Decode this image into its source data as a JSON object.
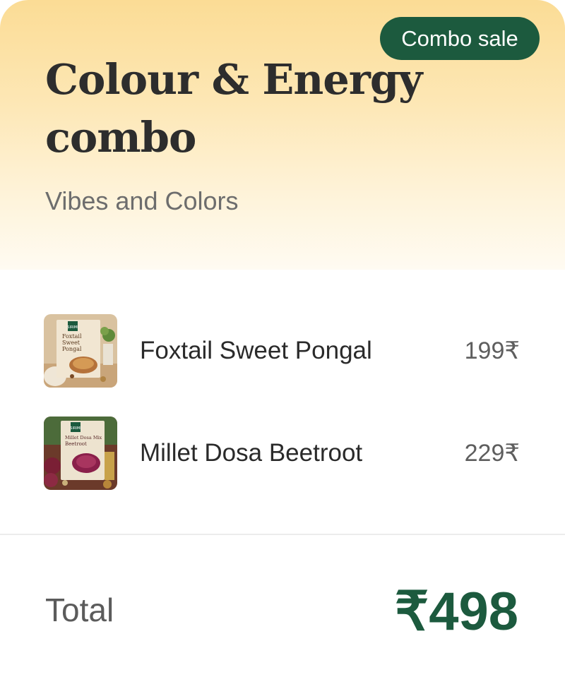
{
  "badge": {
    "label": "Combo sale",
    "color": "#1c5a3e"
  },
  "header": {
    "title": "Colour & Energy combo",
    "subtitle": "Vibes and Colors"
  },
  "items": [
    {
      "name": "Foxtail Sweet Pongal",
      "price": "199₹",
      "thumb": {
        "brand": "SIRIMI",
        "package_text": "Foxtail Sweet Pongal"
      }
    },
    {
      "name": "Millet Dosa Beetroot",
      "price": "229₹",
      "thumb": {
        "brand": "SIRIMI",
        "package_text": "Millet Dosa Mix Beetroot"
      }
    }
  ],
  "total": {
    "label": "Total",
    "value": "₹498"
  },
  "colors": {
    "accent": "#1c5a3e",
    "header_gradient_top": "#fbdc95",
    "header_gradient_bottom": "#fffbf2"
  }
}
